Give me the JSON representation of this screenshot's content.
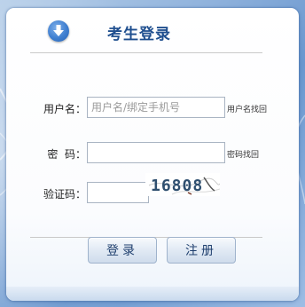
{
  "header": {
    "title": "考生登录",
    "icon": "download-arrow-icon"
  },
  "form": {
    "username": {
      "label": "用户名：",
      "placeholder": "用户名/绑定手机号",
      "value": "",
      "retrieve_link": "用户名找回"
    },
    "password": {
      "label": "密  码：",
      "placeholder": "",
      "value": "",
      "retrieve_link": "密码找回"
    },
    "captcha": {
      "label": "验证码：",
      "placeholder": "",
      "value": "",
      "image_text": "16808"
    }
  },
  "buttons": {
    "login_label": "登录",
    "register_label": "注册"
  },
  "colors": {
    "title": "#1f4f8f",
    "icon": "#3f7fd0",
    "background": "#7aa3d6"
  }
}
